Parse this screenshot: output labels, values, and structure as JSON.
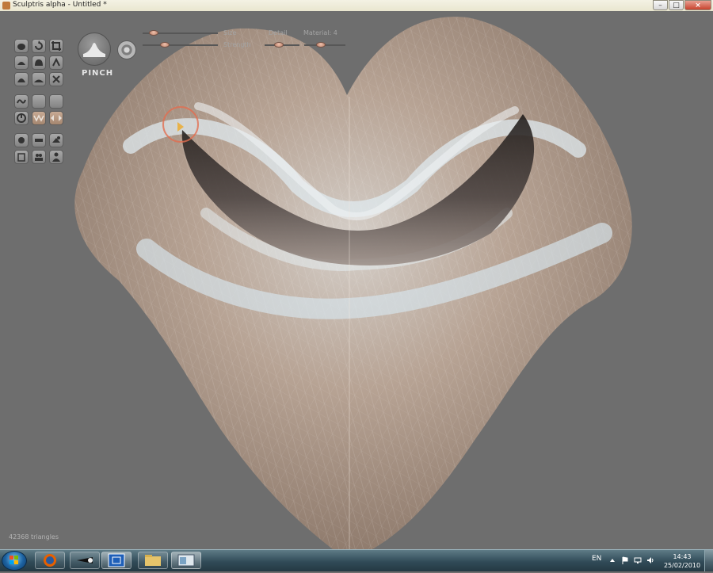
{
  "window": {
    "title": "Sculptris alpha - Untitled *",
    "minimize_glyph": "–",
    "maximize_glyph": "□",
    "close_glyph": "×"
  },
  "toolbar": {
    "brush_label": "PINCH",
    "size_label": "Size",
    "strength_label": "Strength",
    "detail_label": "Detail",
    "material_label": "Material: 4"
  },
  "tools": [
    {
      "name": "sphere-tool",
      "icon": "sphere-icon"
    },
    {
      "name": "rotate-tool",
      "icon": "rotate-icon"
    },
    {
      "name": "crop-tool",
      "icon": "crop-icon"
    },
    {
      "name": "flatten-tool",
      "icon": "flatten-icon"
    },
    {
      "name": "inflate-tool",
      "icon": "inflate-icon"
    },
    {
      "name": "lasso-tool",
      "icon": "lasso-icon"
    },
    {
      "name": "grab-tool",
      "icon": "grab-icon"
    },
    {
      "name": "smooth-tool",
      "icon": "smooth-icon"
    },
    {
      "name": "reduce-tool",
      "icon": "reduce-icon"
    },
    {
      "name": "symmetry-tool",
      "icon": "symmetry-icon"
    },
    {
      "name": "blank-tool-1",
      "icon": "blank-icon"
    },
    {
      "name": "blank-tool-2",
      "icon": "blank-icon"
    },
    {
      "name": "power-tool",
      "icon": "power-icon"
    },
    {
      "name": "pinch-tool",
      "icon": "pinch-icon"
    },
    {
      "name": "mirror-tool",
      "icon": "mirror-icon"
    },
    {
      "name": "material-tool",
      "icon": "material-icon"
    },
    {
      "name": "flatten-mask-tool",
      "icon": "mask-icon"
    },
    {
      "name": "layers-tool",
      "icon": "layers-icon"
    },
    {
      "name": "figure-tool",
      "icon": "figure-icon"
    },
    {
      "name": "group-tool",
      "icon": "group-icon"
    },
    {
      "name": "people-tool",
      "icon": "people-icon"
    }
  ],
  "sliders": {
    "size_value": 0.15,
    "strength_value": 0.29,
    "detail_value": 0.4,
    "material_value": 0.4
  },
  "status": {
    "triangles": "42368 triangles"
  },
  "taskbar": {
    "apps": [
      "firefox-icon",
      "steam-icon",
      "sculptris-icon",
      "explorer-icon",
      "window-icon"
    ],
    "language": "EN",
    "time": "14:43",
    "date": "25/02/2010"
  },
  "colors": {
    "background": "#6f6f6f",
    "mesh": "#b8a596",
    "accent": "#e26e50"
  }
}
